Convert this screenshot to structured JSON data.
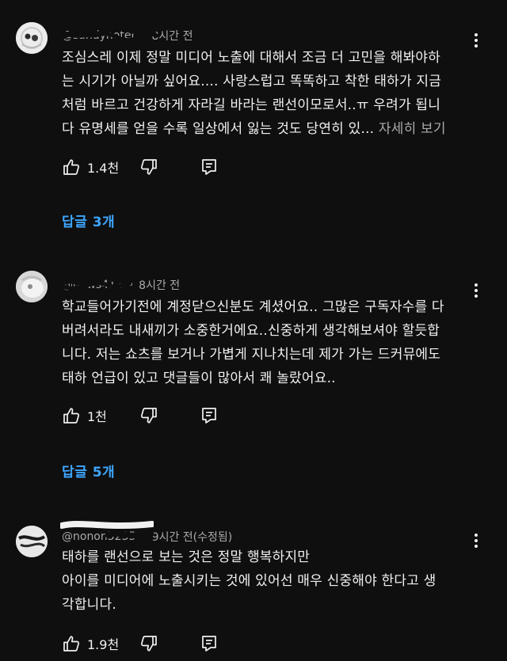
{
  "comments": [
    {
      "author": "@sandynoter",
      "time": "8시간 전",
      "lines": [
        "조심스레 이제 정말 미디어 노출에 대해서 조금 더 고민을 해봐야하",
        "는 시기가 아닐까 싶어요.... 사랑스럽고 똑똑하고 착한 태하가 지금",
        "처럼 바르고 건강하게 자라길 바라는 랜선이모로서..ㅠ 우려가 됩니",
        "다 유명세를 얻을 수록 일상에서 잃는 것도 당연히 있..."
      ],
      "read_more": "자세히 보기",
      "likes": "1.4천",
      "replies": "답글 3개"
    },
    {
      "author": "@hows412",
      "time": "8시간 전",
      "lines": [
        "학교들어가기전에 계정닫으신분도 계셨어요.. 그많은 구독자수를 다",
        "버려서라도 내새끼가 소중한거에요..신중하게 생각해보셔야 할듯합",
        "니다. 저는 쇼츠를 보거나 가볍게 지나치는데 제가 가는 드커뮤에도",
        "태하 언급이 있고 댓글들이 많아서 쾌 놀랐어요.."
      ],
      "likes": "1천",
      "replies": "답글 5개"
    },
    {
      "author": "@nonon5235",
      "time": "9시간 전(수정됨)",
      "lines": [
        "태하를 랜선으로 보는 것은 정말 행복하지만",
        "아이를 미디어에 노출시키는 것에 있어선 매우 신중해야 한다고 생",
        "각합니다."
      ],
      "likes": "1.9천"
    }
  ],
  "icons": {
    "like": "thumbs-up-icon",
    "dislike": "thumbs-down-icon",
    "reply": "reply-comment-icon",
    "more": "more-vert-icon"
  },
  "colors": {
    "background": "#0f0f0f",
    "text": "#f1f1f1",
    "secondary": "#aaaaaa",
    "link": "#3ea6ff"
  }
}
